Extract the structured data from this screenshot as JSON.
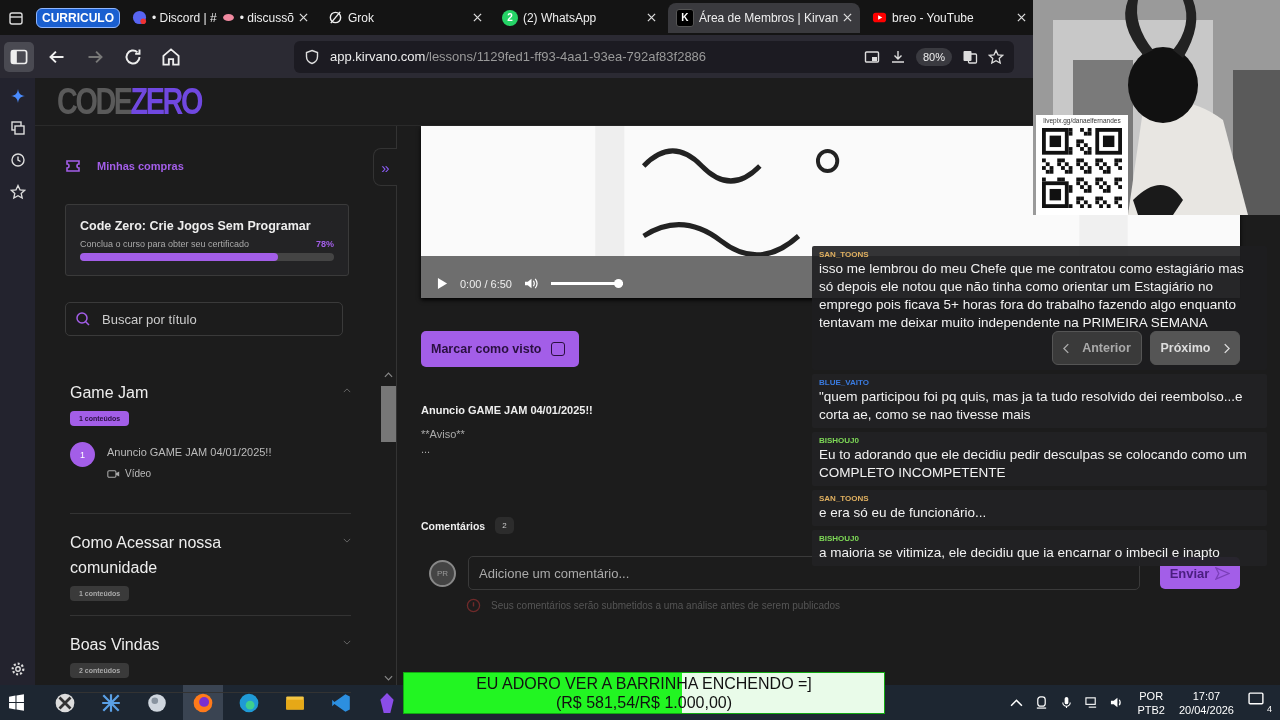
{
  "tab_group": {
    "label": "CURRICULO"
  },
  "tabs": [
    {
      "kind": "chat",
      "title": "• Discord | #",
      "title_rest": "• discussõ",
      "selected": false
    },
    {
      "kind": "slash",
      "title": "Grok",
      "selected": false
    },
    {
      "kind": "count",
      "icon_text": "2",
      "title": "(2) WhatsApp",
      "selected": false
    },
    {
      "kind": "letter",
      "icon_text": "K",
      "title": "Área de Membros | Kirvan",
      "selected": true
    },
    {
      "kind": "video",
      "title": "breo - YouTube",
      "selected": false
    }
  ],
  "address_bar": {
    "host": "app.kirvano.com",
    "path": "/lessons/1129fed1-ff93-4aa1-93ea-792af83f2886",
    "zoom": "80%"
  },
  "logo": {
    "part_1": "CODE",
    "part_2": "ZERO"
  },
  "course_sidebar": {
    "purchases_link": "Minhas compras",
    "collapse_button": "»",
    "course": {
      "title": "Code Zero: Crie Jogos Sem Programar",
      "subtitle": "Conclua o curso para obter seu certificado",
      "percent": "78%",
      "level": 0.78
    },
    "search": {
      "placeholder": "Buscar por título"
    },
    "modules": [
      {
        "title": "Game Jam",
        "count": "1 conteúdos",
        "expanded": true,
        "lessons": [
          {
            "number": "1",
            "title": "Anuncio GAME JAM 04/01/2025!!",
            "type": "Vídeo"
          }
        ]
      },
      {
        "title": "Como Acessar nossa comunidade",
        "count": "1 conteúdos",
        "expanded": false
      },
      {
        "title": "Boas Vindas",
        "count": "2 conteúdos",
        "expanded": false
      }
    ]
  },
  "video_player": {
    "kind": "picture",
    "time": "0:00 / 6:50",
    "volume": {
      "level": 1
    }
  },
  "mark_seen_button": {
    "label": "Marcar como visto",
    "checked": false
  },
  "nav": [
    {
      "label": "Anterior",
      "disabled": true
    },
    {
      "label": "Próximo",
      "disabled": false
    }
  ],
  "lesson": {
    "title": "Anuncio GAME JAM 04/01/2025!!",
    "body": [
      "**Aviso**",
      "..."
    ]
  },
  "comments": {
    "heading": "Comentários",
    "count": "2",
    "avatar": "PR",
    "placeholder": "Adicione um comentário...",
    "notice": "Seus comentários serão submetidos a uma análise antes de serem publicados",
    "submit": "Enviar"
  },
  "chat": [
    {
      "user": "SAN_TOONS",
      "color": "#e0b060",
      "text": "isso me lembrou do meu Chefe que me contratou como estagiário mas só depois ele notou que não tinha como orientar um Estagiário no emprego pois ficava 5+ horas fora do trabalho fazendo algo enquanto tentavam me deixar muito independente na PRIMEIRA SEMANA"
    },
    {
      "user": "BLUE_VAITO",
      "color": "#3a7be0",
      "text": "\"quem participou foi pq quis, mas ja ta tudo resolvido dei reembolso...e corta ae, como se nao tivesse mais"
    },
    {
      "user": "BISHOUJ0",
      "color": "#7ed957",
      "text": "Eu to adorando que ele decidiu pedir desculpas se colocando como um COMPLETO INCOMPETENTE"
    },
    {
      "user": "SAN_TOONS",
      "color": "#e0b060",
      "text": "e era só eu de funcionário..."
    },
    {
      "user": "BISHOUJ0",
      "color": "#7ed957",
      "text": "a maioria se vitimiza, ele decidiu que ia encarnar o imbecil e inapto"
    }
  ],
  "stream_overlay": {
    "donation_url": "livepix.gg/danaelfernandes"
  },
  "donation_goal": {
    "title": "EU ADORO VER A BARRINHA ENCHENDO =]",
    "amount": "(R$ 581,54/R$ 1.000,00)",
    "level": 0.58
  },
  "taskbar": {
    "apps": [
      {
        "kind": "cross",
        "selected": false
      },
      {
        "kind": "star",
        "selected": false
      },
      {
        "kind": "disc",
        "selected": false
      },
      {
        "kind": "fox",
        "selected": true
      },
      {
        "kind": "wave",
        "selected": false
      },
      {
        "kind": "folder",
        "selected": false
      },
      {
        "kind": "code",
        "selected": false
      },
      {
        "kind": "gem",
        "selected": false
      }
    ],
    "language": "POR",
    "layout": "PTB2",
    "time": "17:07",
    "date": "20/04/2026",
    "notifications": "4"
  }
}
